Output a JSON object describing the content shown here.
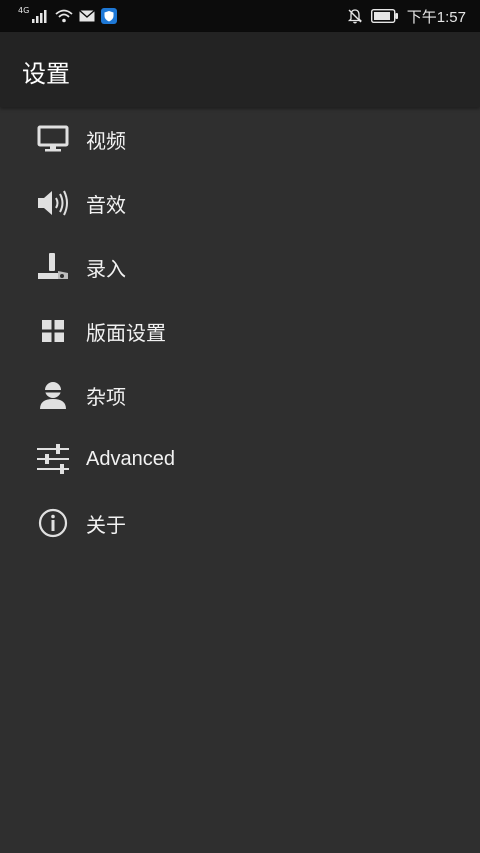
{
  "status_bar": {
    "network_label": "4G",
    "time": "下午1:57"
  },
  "app_bar": {
    "title": "设置"
  },
  "menu": {
    "items": [
      {
        "label": "视频",
        "icon": "monitor-icon"
      },
      {
        "label": "音效",
        "icon": "speaker-icon"
      },
      {
        "label": "录入",
        "icon": "joystick-icon"
      },
      {
        "label": "版面设置",
        "icon": "grid-icon"
      },
      {
        "label": "杂项",
        "icon": "user-icon"
      },
      {
        "label": "Advanced",
        "icon": "sliders-icon"
      },
      {
        "label": "关于",
        "icon": "info-icon"
      }
    ]
  },
  "colors": {
    "status_bar_bg": "#0c0c0c",
    "app_bar_bg": "#232323",
    "background": "#2f2f2f",
    "text": "#f2f2f2",
    "icon": "#e0e0e0"
  }
}
